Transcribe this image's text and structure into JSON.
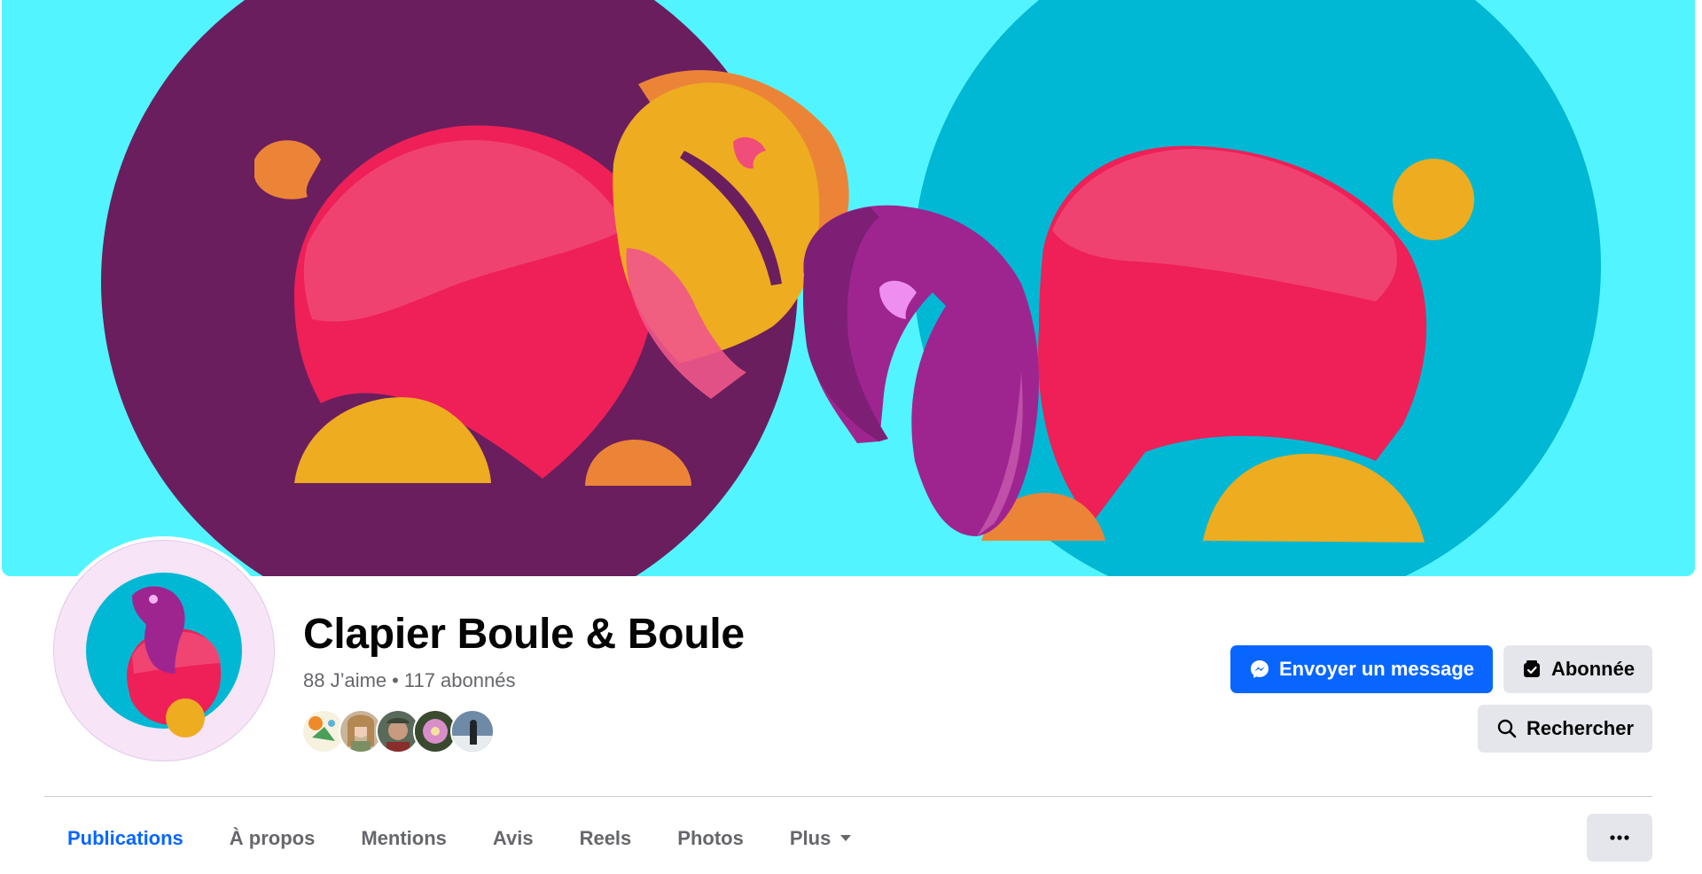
{
  "page": {
    "name": "Clapier Boule & Boule",
    "likes": "88 J’aime",
    "stats_separator": "•",
    "followers": "117 abonnés"
  },
  "actions": {
    "message_label": "Envoyer un message",
    "follow_label": "Abonnée",
    "search_label": "Rechercher"
  },
  "follower_avatars": [
    "avatar-1",
    "avatar-2",
    "avatar-3",
    "avatar-4",
    "avatar-5"
  ],
  "tabs": [
    {
      "label": "Publications",
      "active": true
    },
    {
      "label": "À propos"
    },
    {
      "label": "Mentions"
    },
    {
      "label": "Avis"
    },
    {
      "label": "Reels"
    },
    {
      "label": "Photos"
    },
    {
      "label": "Plus"
    }
  ],
  "colors": {
    "accent": "#0866ff",
    "cover_background": "#52f5ff",
    "purple_circle": "#6a1e5e",
    "teal_circle": "#00b8d4",
    "pink_body": "#ee2057",
    "yellow": "#eeac20",
    "orange": "#ec8437",
    "magenta": "#9e2590"
  },
  "icons": {
    "message": "messenger-icon",
    "follow": "inbox-check-icon",
    "search": "search-icon",
    "tab_more": "caret-down-icon",
    "more": "ellipsis-icon"
  }
}
